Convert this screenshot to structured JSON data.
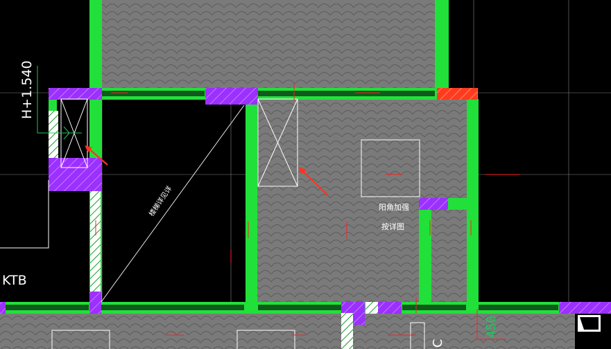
{
  "drawing": {
    "elevation_label": "H+1.540",
    "stair_note": "楼梯详见详",
    "corner_note_line1": "阳角加强",
    "corner_note_line2": "按详图",
    "room_tag": "KTB",
    "dimension_value": "450",
    "partial_label": "C"
  },
  "colors": {
    "background": "#000000",
    "wall_green": "#22e03a",
    "wall_dark_green": "#0f5a1c",
    "column_purple": "#9b30ff",
    "column_red": "#ff3b1f",
    "slab_gray": "#7a7a7a",
    "line_white": "#ffffff",
    "axis_red": "#ff2020",
    "arrow_red": "#ff3322"
  }
}
